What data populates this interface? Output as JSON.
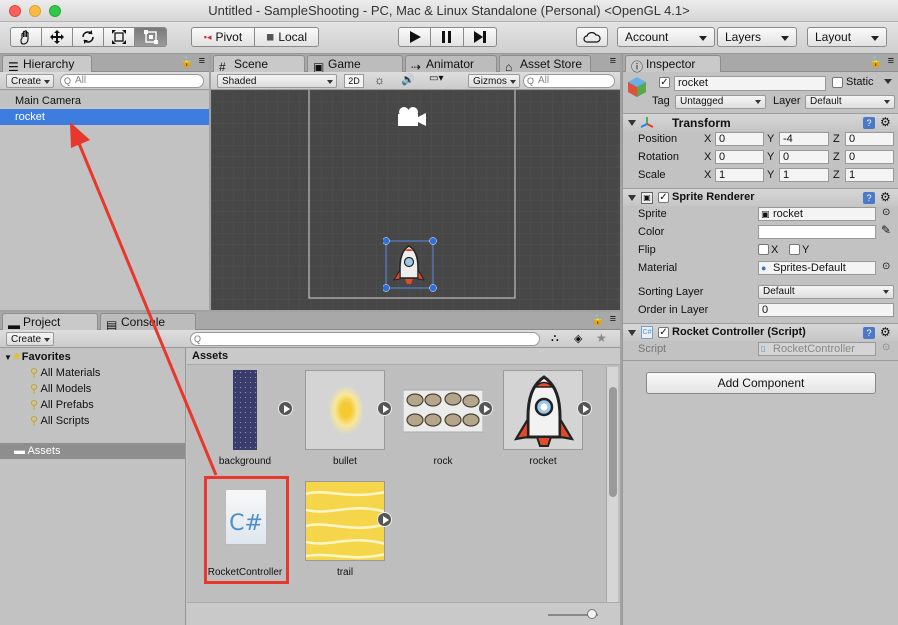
{
  "window": {
    "title": "Untitled - SampleShooting - PC, Mac & Linux Standalone (Personal) <OpenGL 4.1>"
  },
  "toolbar": {
    "pivot_label": "Pivot",
    "local_label": "Local",
    "account_label": "Account",
    "layers_label": "Layers",
    "layout_label": "Layout"
  },
  "hierarchy": {
    "tab_label": "Hierarchy",
    "create_label": "Create",
    "search_placeholder": "All",
    "items": [
      {
        "label": "Main Camera",
        "selected": false
      },
      {
        "label": "rocket",
        "selected": true
      }
    ]
  },
  "scene": {
    "tabs": [
      "Scene",
      "Game",
      "Animator",
      "Asset Store"
    ],
    "shading_mode": "Shaded",
    "mode_2d_label": "2D",
    "gizmos_label": "Gizmos",
    "search_placeholder": "All"
  },
  "project": {
    "tabs": [
      "Project",
      "Console"
    ],
    "create_label": "Create",
    "favorites_label": "Favorites",
    "favorites": [
      "All Materials",
      "All Models",
      "All Prefabs",
      "All Scripts"
    ],
    "assets_root_label": "Assets",
    "breadcrumb": "Assets",
    "assets": [
      {
        "name": "background"
      },
      {
        "name": "bullet"
      },
      {
        "name": "rock"
      },
      {
        "name": "rocket"
      },
      {
        "name": "RocketController"
      },
      {
        "name": "trail"
      }
    ],
    "script_icon_text": "C#"
  },
  "inspector": {
    "tab_label": "Inspector",
    "object_name": "rocket",
    "static_label": "Static",
    "tag_label": "Tag",
    "tag_value": "Untagged",
    "layer_label": "Layer",
    "layer_value": "Default",
    "transform": {
      "title": "Transform",
      "rows": [
        {
          "label": "Position",
          "x": "0",
          "y": "-4",
          "z": "0"
        },
        {
          "label": "Rotation",
          "x": "0",
          "y": "0",
          "z": "0"
        },
        {
          "label": "Scale",
          "x": "1",
          "y": "1",
          "z": "1"
        }
      ],
      "axis_x": "X",
      "axis_y": "Y",
      "axis_z": "Z"
    },
    "sprite_renderer": {
      "title": "Sprite Renderer",
      "sprite_label": "Sprite",
      "sprite_value": "rocket",
      "color_label": "Color",
      "flip_label": "Flip",
      "flip_x": "X",
      "flip_y": "Y",
      "material_label": "Material",
      "material_value": "Sprites-Default",
      "sorting_layer_label": "Sorting Layer",
      "sorting_layer_value": "Default",
      "order_label": "Order in Layer",
      "order_value": "0"
    },
    "script_component": {
      "title": "Rocket Controller (Script)",
      "script_label": "Script",
      "script_value": "RocketController"
    },
    "add_component_label": "Add Component"
  },
  "colors": {
    "selection": "#3e7de0",
    "annotation": "#e8372c"
  }
}
